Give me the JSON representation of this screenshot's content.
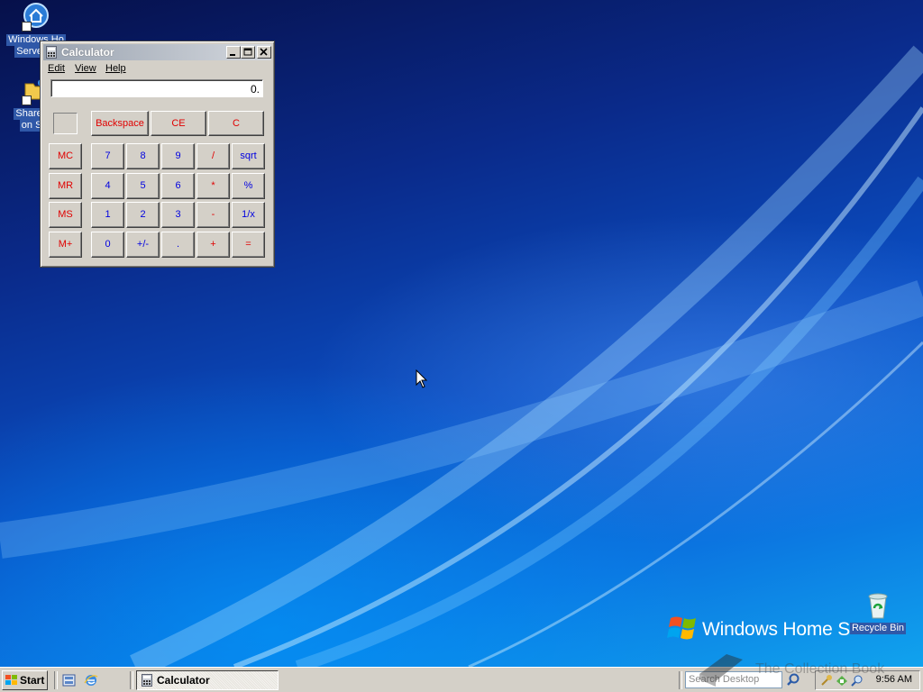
{
  "desktop": {
    "icons": [
      {
        "label_lines": [
          "Windows Ho",
          "Server C"
        ],
        "icon": "home-server-icon"
      },
      {
        "label_lines": [
          "Shared F",
          "on Ser"
        ],
        "icon": "shared-folders-icon"
      },
      {
        "label_lines": [
          "Recycle Bin"
        ],
        "icon": "recycle-bin-icon"
      }
    ],
    "brand_text": "Windows Home Se"
  },
  "window": {
    "title": "Calculator",
    "menu": [
      "Edit",
      "View",
      "Help"
    ],
    "display_value": "0.",
    "top_keys": [
      "Backspace",
      "CE",
      "C"
    ],
    "memory_keys": [
      "MC",
      "MR",
      "MS",
      "M+"
    ],
    "keypad": [
      [
        "7",
        "8",
        "9",
        "/",
        "sqrt"
      ],
      [
        "4",
        "5",
        "6",
        "*",
        "%"
      ],
      [
        "1",
        "2",
        "3",
        "-",
        "1/x"
      ],
      [
        "0",
        "+/-",
        ".",
        "+",
        "="
      ]
    ],
    "colors": {
      "digit": "#0000e0",
      "operator": "#e00000"
    }
  },
  "taskbar": {
    "start_label": "Start",
    "quick_launch": [
      "server-manager-icon",
      "internet-explorer-icon"
    ],
    "task_button": "Calculator",
    "search_placeholder": "Search Desktop",
    "clock": "9:56 AM",
    "watermark": "The Collection Book"
  }
}
